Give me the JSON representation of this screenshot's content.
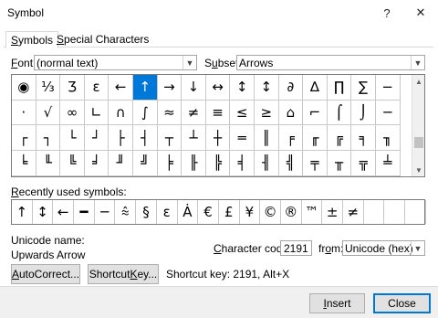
{
  "window": {
    "title": "Symbol",
    "help": "?",
    "close": "✕"
  },
  "tabs": [
    {
      "pre": "",
      "u": "S",
      "post": "ymbols"
    },
    {
      "pre": "",
      "u": "S",
      "post": "pecial Characters"
    }
  ],
  "font": {
    "label_u": "F",
    "label_rest": "ont:",
    "value": "(normal text)"
  },
  "subset": {
    "label_pre": "S",
    "label_u": "u",
    "label_rest": "bset:",
    "value": "Arrows"
  },
  "grid": {
    "rows": [
      [
        "◉",
        "⅓",
        "Ʒ",
        "ε",
        "←",
        "↑",
        "→",
        "↓",
        "↔",
        "↕",
        "↕",
        "∂",
        "∆",
        "∏",
        "∑",
        "−"
      ],
      [
        "·",
        "√",
        "∞",
        "∟",
        "∩",
        "∫",
        "≈",
        "≠",
        "≡",
        "≤",
        "≥",
        "⌂",
        "⌐",
        "⌠",
        "⌡",
        "─"
      ],
      [
        "┌",
        "┐",
        "└",
        "┘",
        "├",
        "┤",
        "┬",
        "┴",
        "┼",
        "═",
        "║",
        "╒",
        "╓",
        "╔",
        "╕",
        "╖"
      ],
      [
        "╘",
        "╙",
        "╚",
        "╛",
        "╜",
        "╝",
        "╞",
        "╟",
        "╠",
        "╡",
        "╢",
        "╣",
        "╤",
        "╥",
        "╦",
        "╧"
      ]
    ],
    "selected_row": 0,
    "selected_col": 5
  },
  "recent": {
    "label_u": "R",
    "label_rest": "ecently used symbols:",
    "symbols": [
      "↑",
      "↕",
      "←",
      "━",
      "─",
      "⩯",
      "§",
      "ε",
      "Ȧ",
      "€",
      "£",
      "¥",
      "©",
      "®",
      "™",
      "±",
      "≠",
      "",
      "",
      ""
    ]
  },
  "unicode": {
    "name_label": "Unicode name:",
    "name_value": "Upwards Arrow"
  },
  "charcode": {
    "label_u": "C",
    "label_rest": "haracter code:",
    "value": "2191"
  },
  "from": {
    "label_pre": "fr",
    "label_u": "o",
    "label_rest": "m:",
    "value": "Unicode (hex)"
  },
  "buttons": {
    "autocorrect_u": "A",
    "autocorrect_rest": "utoCorrect...",
    "shortcut_pre": "Shortcut ",
    "shortcut_u": "K",
    "shortcut_rest": "ey...",
    "insert_u": "I",
    "insert_rest": "nsert",
    "close": "Close"
  },
  "shortcut_text": "Shortcut key: 2191, Alt+X",
  "colors": {
    "selection": "#0078d7",
    "button_bg": "#e1e1e1",
    "focus_border": "#0078d7"
  },
  "icons": [
    "chevron-down-icon",
    "scroll-up-icon",
    "scroll-down-icon",
    "help-icon",
    "close-icon"
  ]
}
